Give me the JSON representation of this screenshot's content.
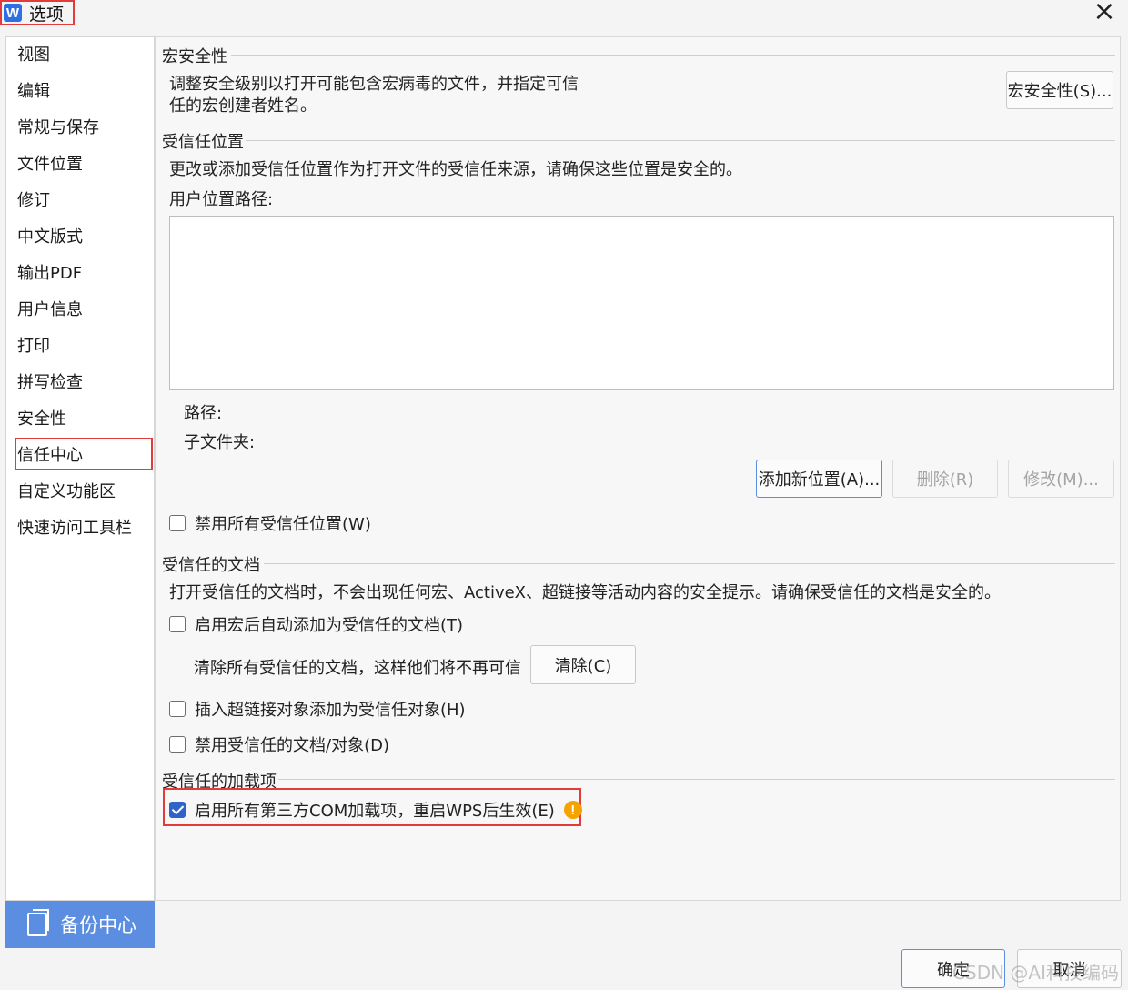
{
  "window": {
    "title": "选项",
    "logo": "W",
    "close_glyph": "×"
  },
  "sidebar": {
    "items": [
      "视图",
      "编辑",
      "常规与保存",
      "文件位置",
      "修订",
      "中文版式",
      "输出PDF",
      "用户信息",
      "打印",
      "拼写检查",
      "安全性",
      "信任中心",
      "自定义功能区",
      "快速访问工具栏"
    ],
    "selected_index": 11,
    "backup_label": "备份中心"
  },
  "macro": {
    "heading": "宏安全性",
    "desc_line1": "调整安全级别以打开可能包含宏病毒的文件，并指定可信",
    "desc_line2": "任的宏创建者姓名。",
    "button": "宏安全性(S)..."
  },
  "trusted_locations": {
    "heading": "受信任位置",
    "desc": "更改或添加受信任位置作为打开文件的受信任来源，请确保这些位置是安全的。",
    "path_label": "用户位置路径:",
    "path_field_label": "路径:",
    "subfolder_label": "子文件夹:",
    "add_button": "添加新位置(A)...",
    "delete_button": "删除(R)",
    "modify_button": "修改(M)...",
    "disable_all_label": "禁用所有受信任位置(W)",
    "disable_all_checked": false
  },
  "trusted_docs": {
    "heading": "受信任的文档",
    "desc": "打开受信任的文档时，不会出现任何宏、ActiveX、超链接等活动内容的安全提示。请确保受信任的文档是安全的。",
    "auto_add_label": "启用宏后自动添加为受信任的文档(T)",
    "auto_add_checked": false,
    "clear_text": "清除所有受信任的文档，这样他们将不再可信",
    "clear_button": "清除(C)",
    "hyperlink_label": "插入超链接对象添加为受信任对象(H)",
    "hyperlink_checked": false,
    "disable_label": "禁用受信任的文档/对象(D)",
    "disable_checked": false
  },
  "trusted_addins": {
    "heading": "受信任的加载项",
    "com_label": "启用所有第三方COM加载项，重启WPS后生效(E)",
    "com_checked": true,
    "warn_glyph": "!"
  },
  "footer": {
    "ok": "确定",
    "cancel": "取消"
  },
  "watermark": "CSDN @AI科技编码",
  "colors": {
    "accent": "#2e63c9",
    "highlight": "#e23b3b",
    "backup_bg": "#5b8de0",
    "warning": "#f5a300"
  }
}
